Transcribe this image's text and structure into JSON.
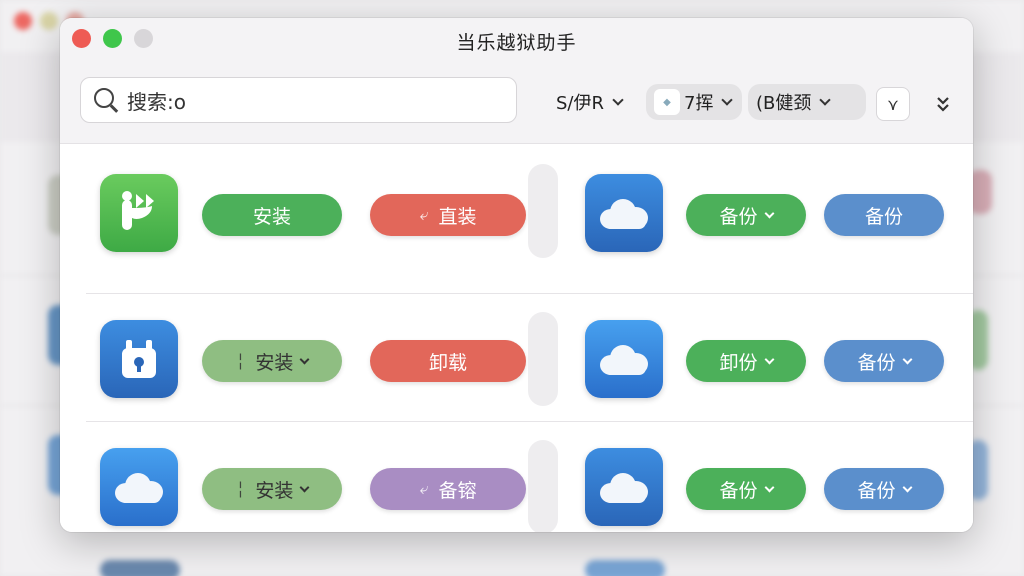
{
  "window": {
    "title": "当乐越狱助手"
  },
  "toolbar": {
    "search_placeholder": "搜索:o",
    "filter_1": "S/伊R",
    "filter_2": "7挥",
    "filter_3": "(B健颈",
    "sq_button_glyph": "⋎",
    "expand_glyph": "⌄⌄"
  },
  "rows": [
    {
      "left_icon": "app-logo-icon",
      "install_label": "安装",
      "second_label": "直装",
      "right_icon": "cloud-icon",
      "right_btn1_label": "备份",
      "right_btn2_label": "备份"
    },
    {
      "left_icon": "robot-lock-icon",
      "install_label": "安装",
      "second_label": "卸载",
      "right_icon": "cloud-icon",
      "right_btn1_label": "卸份",
      "right_btn2_label": "备份"
    },
    {
      "left_icon": "cloud-icon",
      "install_label": "安装",
      "second_label": "备镕",
      "right_icon": "cloud-icon",
      "right_btn1_label": "备份",
      "right_btn2_label": "备份"
    }
  ],
  "colors": {
    "install_green": "#4cb05a",
    "uninstall_red": "#e2675a",
    "purple": "#a98dc3",
    "blue": "#5b8fcc",
    "muted_green": "#8fbe82"
  }
}
